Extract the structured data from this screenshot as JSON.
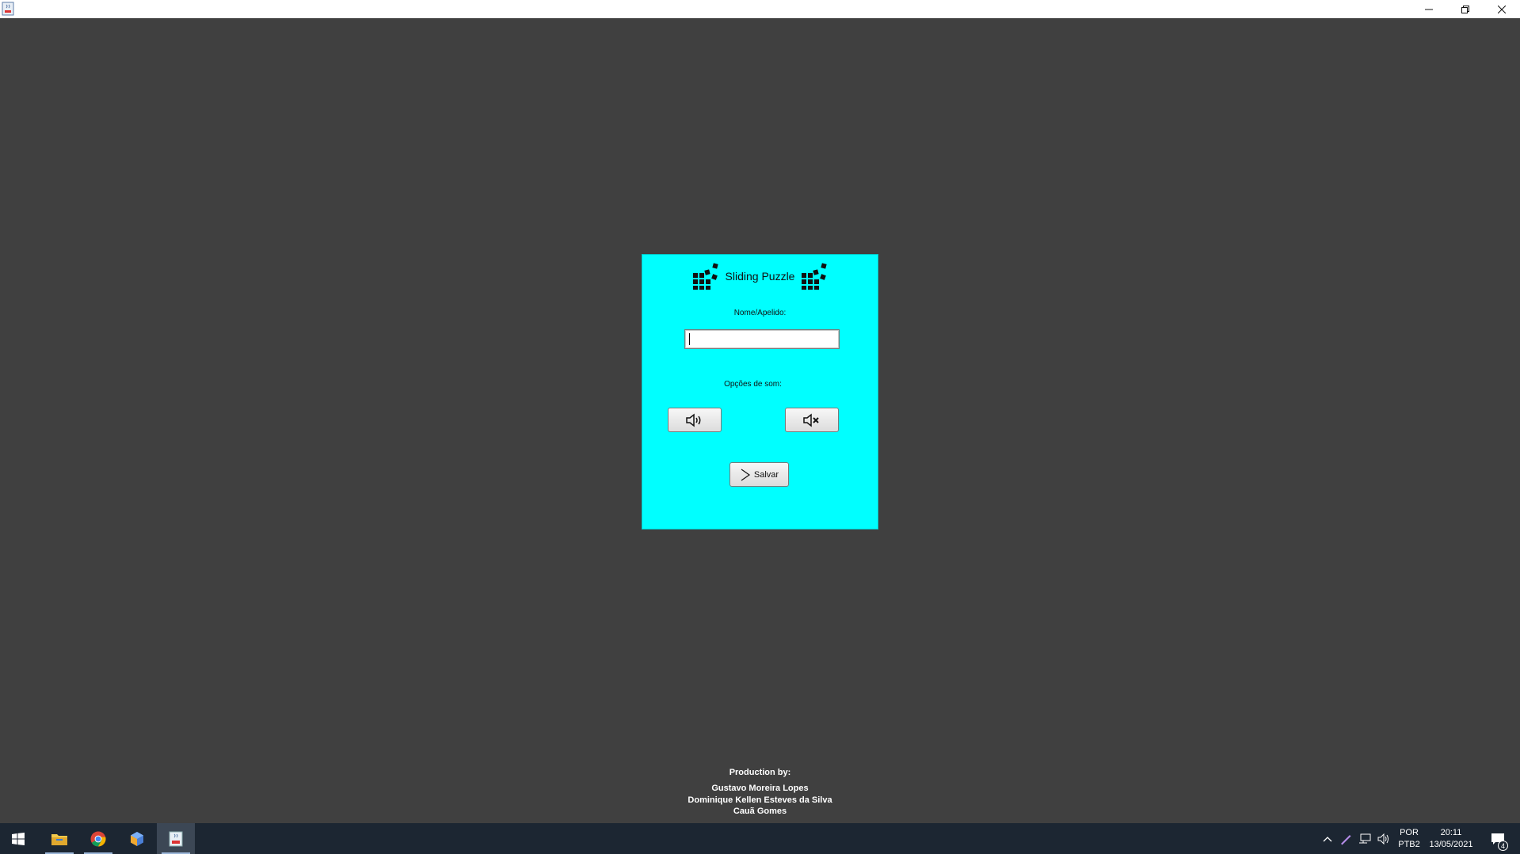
{
  "window": {
    "title": "",
    "controls": {
      "minimize": "minimize-icon",
      "maximize": "restore-icon",
      "close": "close-icon"
    }
  },
  "panel": {
    "background": "#00ffff",
    "title": "Sliding Puzzle",
    "name_label": "Nome/Apelido:",
    "name_input": {
      "value": "",
      "placeholder": ""
    },
    "sound_label": "Opções de som:",
    "sound_on_icon": "speaker-on-icon",
    "sound_off_icon": "speaker-mute-icon",
    "save_button": {
      "label": "Salvar",
      "icon": "chevron-right-icon"
    }
  },
  "credits": {
    "title": "Production by:",
    "names": [
      "Gustavo Moreira Lopes",
      "Dominique Kellen Esteves da Silva",
      "Cauã Gomes"
    ]
  },
  "taskbar": {
    "apps": [
      "windows-start-icon",
      "file-explorer-icon",
      "chrome-icon",
      "box-app-icon",
      "java-app-icon"
    ],
    "tray": {
      "language": "POR",
      "layout": "PTB2",
      "time": "20:11",
      "date": "13/05/2021",
      "notification_count": "4"
    }
  }
}
